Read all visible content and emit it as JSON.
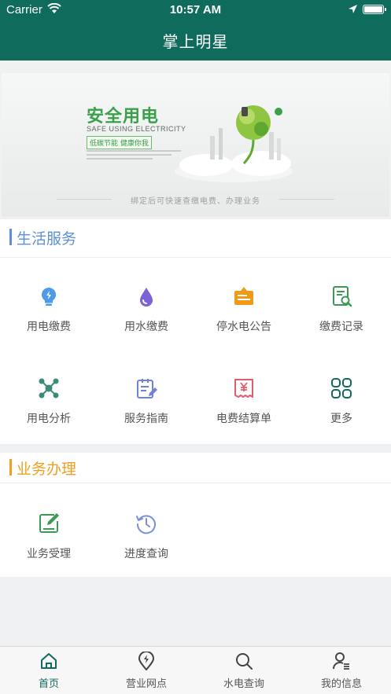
{
  "status_bar": {
    "carrier": "Carrier",
    "time": "10:57 AM"
  },
  "header": {
    "title": "掌上明星"
  },
  "banner": {
    "headline": "安全用电",
    "subtitle": "SAFE USING ELECTRICITY",
    "tag": "低碳节能  健康你我",
    "caption": "绑定后可快速查缴电费、办理业务"
  },
  "life_services": {
    "title": "生活服务",
    "accent": "#5b8fd8",
    "items": [
      {
        "label": "用电缴费",
        "icon": "lightbulb-icon",
        "color": "#4d9be6"
      },
      {
        "label": "用水缴费",
        "icon": "water-drop-icon",
        "color": "#7b62d6"
      },
      {
        "label": "停水电公告",
        "icon": "notice-board-icon",
        "color": "#f09b18"
      },
      {
        "label": "缴费记录",
        "icon": "search-document-icon",
        "color": "#3d9a55"
      },
      {
        "label": "用电分析",
        "icon": "network-nodes-icon",
        "color": "#3b8a7a"
      },
      {
        "label": "服务指南",
        "icon": "guide-edit-icon",
        "color": "#6f82d8"
      },
      {
        "label": "电费结算单",
        "icon": "yuan-receipt-icon",
        "color": "#e45c6a"
      },
      {
        "label": "更多",
        "icon": "grid-more-icon",
        "color": "#0f6b5c"
      }
    ]
  },
  "business": {
    "title": "业务办理",
    "accent": "#f0a020",
    "items": [
      {
        "label": "业务受理",
        "icon": "form-edit-icon",
        "color": "#3d9a55"
      },
      {
        "label": "进度查询",
        "icon": "history-clock-icon",
        "color": "#7b8fd8"
      }
    ]
  },
  "tabbar": {
    "active_color": "#0f6b5c",
    "tabs": [
      {
        "label": "首页",
        "icon": "home-icon",
        "active": true
      },
      {
        "label": "营业网点",
        "icon": "location-bolt-icon",
        "active": false
      },
      {
        "label": "水电查询",
        "icon": "search-icon",
        "active": false
      },
      {
        "label": "我的信息",
        "icon": "user-list-icon",
        "active": false
      }
    ]
  }
}
